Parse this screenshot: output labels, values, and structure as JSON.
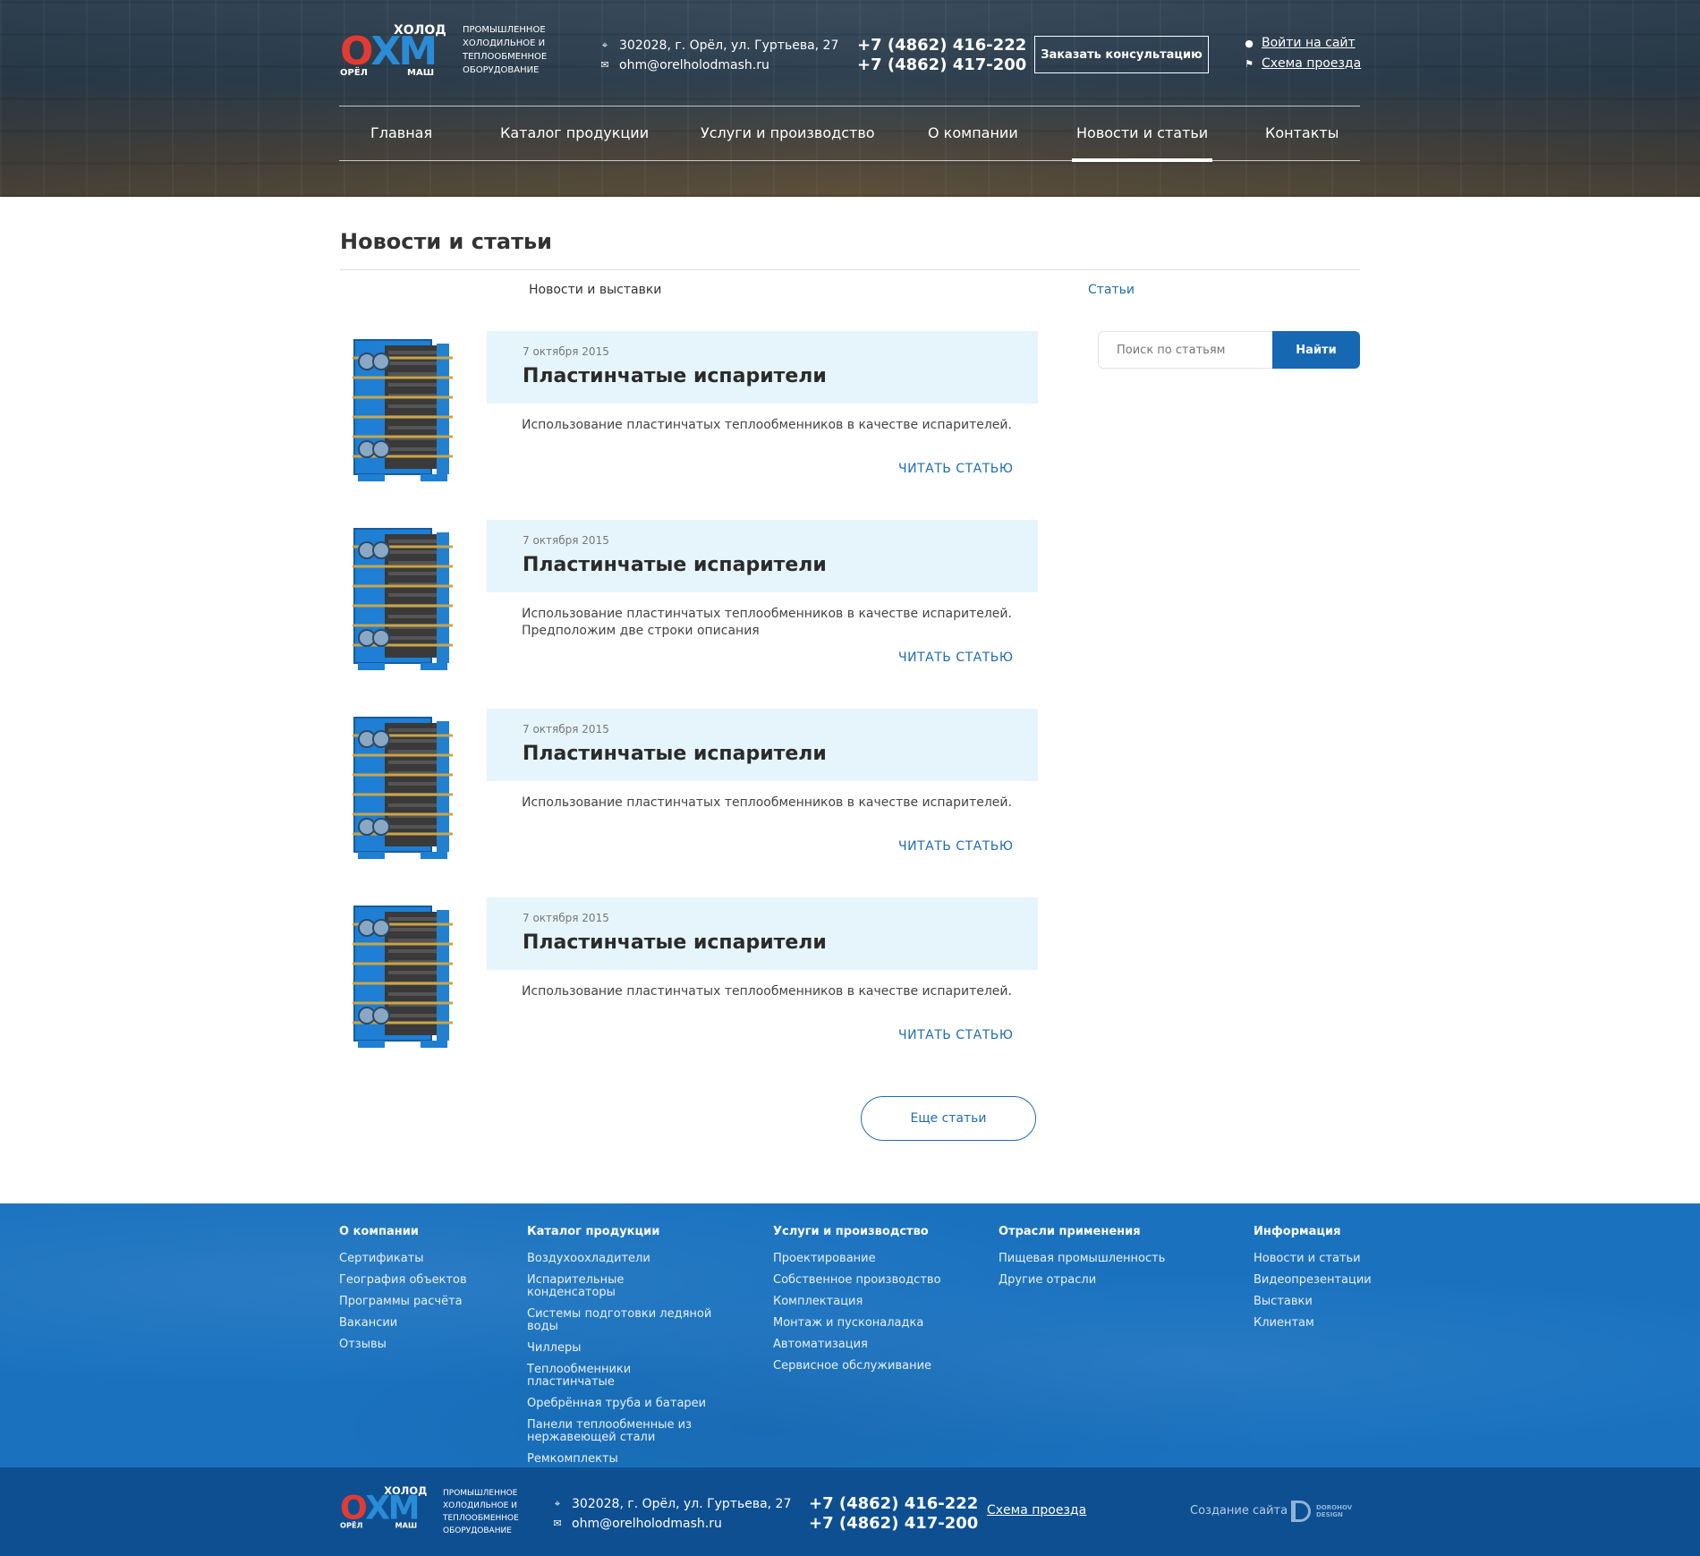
{
  "header": {
    "logo": {
      "mark_left": "О",
      "mark_main": "ХМ",
      "mark_top": "ХОЛОД",
      "mark_city": "ОРЁЛ",
      "mark_mash": "МАШ",
      "tagline": "ПРОМЫШЛЕННОЕ ХОЛОДИЛЬНОЕ И ТЕПЛООБМЕННОЕ ОБОРУДОВАНИЕ"
    },
    "address": "302028, г. Орёл, ул. Гуртьева, 27",
    "email": "ohm@orelholodmash.ru",
    "phone1": "+7 (4862) 416-222",
    "phone2": "+7 (4862) 417-200",
    "consult_button": "Заказать консультацию",
    "login_link": "Войти на сайт",
    "scheme_link": "Схема проезда"
  },
  "nav": [
    {
      "label": "Главная"
    },
    {
      "label": "Каталог продукции"
    },
    {
      "label": "Услуги и производство"
    },
    {
      "label": "О компании"
    },
    {
      "label": "Новости и статьи",
      "active": true
    },
    {
      "label": "Контакты"
    }
  ],
  "page": {
    "title": "Новости и статьи",
    "tabs": [
      {
        "label": "Новости и выставки",
        "active": false
      },
      {
        "label": "Статьи",
        "active": true
      }
    ]
  },
  "articles": [
    {
      "date": "7 октября 2015",
      "title": "Пластинчатые испарители",
      "desc": "Использование пластинчатых теплообменников в качестве испарителей.",
      "read": "ЧИТАТЬ СТАТЬЮ"
    },
    {
      "date": "7 октября 2015",
      "title": "Пластинчатые испарители",
      "desc": "Использование пластинчатых теплообменников в качестве испарителей. Предположим две строки описания",
      "read": "ЧИТАТЬ СТАТЬЮ"
    },
    {
      "date": "7 октября 2015",
      "title": "Пластинчатые испарители",
      "desc": "Использование пластинчатых теплообменников в качестве испарителей.",
      "read": "ЧИТАТЬ СТАТЬЮ"
    },
    {
      "date": "7 октября 2015",
      "title": "Пластинчатые испарители",
      "desc": "Использование пластинчатых теплообменников в качестве испарителей.",
      "read": "ЧИТАТЬ СТАТЬЮ"
    }
  ],
  "more_button": "Еще статьи",
  "search": {
    "placeholder": "Поиск по статьям",
    "button": "Найти"
  },
  "footer": {
    "columns": [
      {
        "title": "О компании",
        "links": [
          "Сертификаты",
          "География объектов",
          "Программы расчёта",
          "Вакансии",
          "Отзывы"
        ]
      },
      {
        "title": "Каталог продукции",
        "links": [
          "Воздухоохладители",
          "Испарительные конденсаторы",
          "Системы подготовки ледяной воды",
          "Чиллеры",
          "Теплообменники пластинчатые",
          "Оребрённая труба и батареи",
          "Панели теплообменные из нержавеющей стали",
          "Ремкомплекты"
        ]
      },
      {
        "title": "Услуги и производство",
        "links": [
          "Проектирование",
          "Собственное производство",
          "Комплектация",
          "Монтаж и пусконаладка",
          "Автоматизация",
          "Сервисное обслуживание"
        ]
      },
      {
        "title": "Отрасли применения",
        "links": [
          "Пищевая промышленность",
          "Другие отрасли"
        ]
      },
      {
        "title": "Информация",
        "links": [
          "Новости и статьи",
          "Видеопрезентации",
          "Выставки",
          "Клиентам"
        ]
      }
    ],
    "address": "302028, г. Орёл, ул. Гуртьева, 27",
    "email": "ohm@orelholodmash.ru",
    "phone1": "+7 (4862) 416-222",
    "phone2": "+7 (4862) 417-200",
    "scheme_link": "Схема проезда",
    "credit": "Создание сайта",
    "studio_line1": "DOROHOV",
    "studio_line2": "DESIGN"
  },
  "colors": {
    "accent": "#1668b3",
    "article_head_bg": "#e5f5fb",
    "footer_bg": "#1a72bf",
    "footer_bottom_bg": "#0e4f92"
  }
}
